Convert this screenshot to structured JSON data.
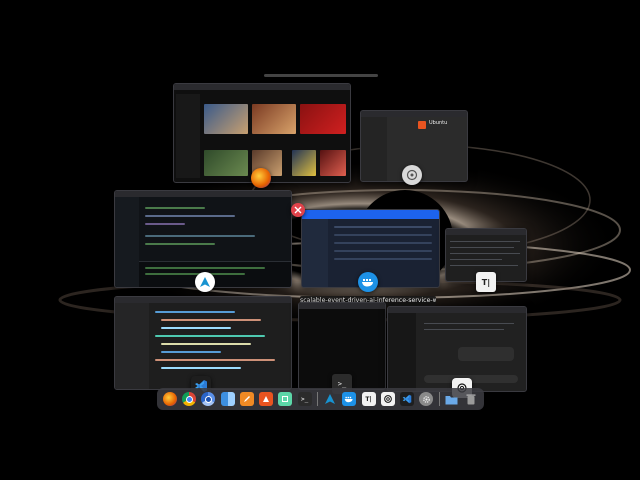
{
  "desktop": {
    "overview_window_title": "scalable-event-driven-ai-inference-service-with-fastap...",
    "windows": [
      {
        "name": "firefox-youtube",
        "app_icon": "firefox-icon"
      },
      {
        "name": "ubuntu-software",
        "app_icon": "ubuntu-icon",
        "header_text": "Ubuntu"
      },
      {
        "name": "terminal-editor",
        "app_icon": "arch-icon"
      },
      {
        "name": "docker-desktop",
        "app_icon": "docker-icon"
      },
      {
        "name": "typora-document",
        "app_icon": "typora-icon",
        "app_label": "T|"
      },
      {
        "name": "vscode-editor",
        "app_icon": "vscode-icon"
      },
      {
        "name": "terminal",
        "app_icon": "terminal-icon",
        "app_label": ">_"
      },
      {
        "name": "chatgpt-window",
        "app_icon": "chatgpt-icon"
      }
    ]
  },
  "dock": {
    "items": [
      {
        "name": "firefox",
        "icon": "firefox-icon",
        "color": "#e66000"
      },
      {
        "name": "chrome",
        "icon": "chrome-icon",
        "color": "#2e8b57"
      },
      {
        "name": "chromium",
        "icon": "chromium-icon",
        "color": "#3b7ddd"
      },
      {
        "name": "finder",
        "icon": "finder-icon",
        "color": "#3d8fe0"
      },
      {
        "name": "pen",
        "icon": "pen-icon",
        "color": "#f08a24"
      },
      {
        "name": "ubuntu-software",
        "icon": "ubuntu-icon",
        "color": "#e95420"
      },
      {
        "name": "cube",
        "icon": "cube-icon",
        "color": "#5cd6a8"
      },
      {
        "name": "terminal",
        "icon": "terminal-icon",
        "color": "#2b2b2b",
        "label": ">_"
      },
      {
        "name": "arch",
        "icon": "arch-icon",
        "color": "#1793d1"
      },
      {
        "name": "docker",
        "icon": "docker-icon",
        "color": "#1d91e6"
      },
      {
        "name": "typora",
        "icon": "typora-icon",
        "color": "#f2f2f2",
        "label": "T|"
      },
      {
        "name": "chatgpt",
        "icon": "chatgpt-icon",
        "color": "#f2f2f2"
      },
      {
        "name": "vscode",
        "icon": "vscode-icon",
        "color": "#2b7bd6"
      },
      {
        "name": "settings",
        "icon": "gear-icon",
        "color": "#8a8a8a"
      },
      {
        "name": "files",
        "icon": "folder-icon",
        "color": "#6aa9e8"
      },
      {
        "name": "trash",
        "icon": "trash-icon",
        "color": "#9a9a9a"
      }
    ]
  },
  "colors": {
    "background": "#000000",
    "docker_blue": "#1d63ed",
    "close_red": "#e0424a"
  }
}
